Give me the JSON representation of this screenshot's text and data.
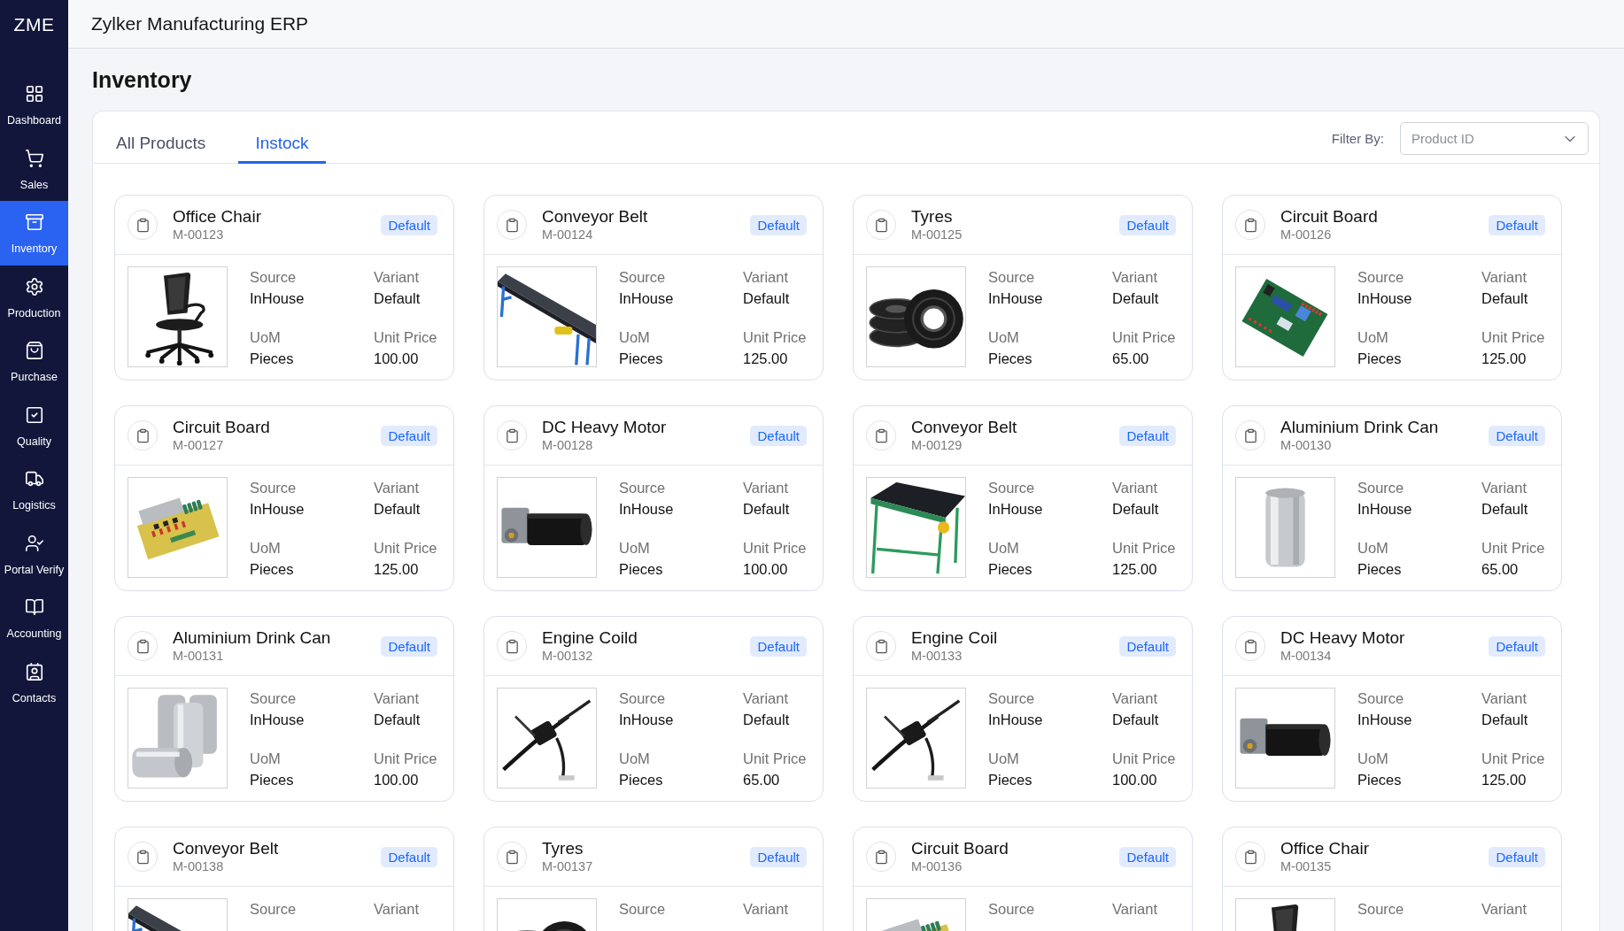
{
  "app": {
    "logo": "ZME",
    "title": "Zylker Manufacturing ERP"
  },
  "sidebar": {
    "items": [
      {
        "label": "Dashboard",
        "selected": false
      },
      {
        "label": "Sales",
        "selected": false
      },
      {
        "label": "Inventory",
        "selected": true
      },
      {
        "label": "Production",
        "selected": false
      },
      {
        "label": "Purchase",
        "selected": false
      },
      {
        "label": "Quality",
        "selected": false
      },
      {
        "label": "Logistics",
        "selected": false
      },
      {
        "label": "Portal Verify",
        "selected": false
      },
      {
        "label": "Accounting",
        "selected": false
      },
      {
        "label": "Contacts",
        "selected": false
      }
    ]
  },
  "page": {
    "title": "Inventory"
  },
  "tabs": [
    {
      "label": "All Products",
      "selected": false
    },
    {
      "label": "Instock",
      "selected": true
    }
  ],
  "filter": {
    "label": "Filter By:",
    "placeholder": "Product ID"
  },
  "products": [
    {
      "name": "Office Chair",
      "code": "M-00123",
      "badge": "Default",
      "kind": "chair",
      "fields": [
        {
          "label": "Source",
          "value": "InHouse"
        },
        {
          "label": "Variant",
          "value": "Default"
        },
        {
          "label": "UoM",
          "value": "Pieces"
        },
        {
          "label": "Unit Price",
          "value": "100.00"
        }
      ]
    },
    {
      "name": "Conveyor Belt",
      "code": "M-00124",
      "badge": "Default",
      "kind": "conveyor",
      "fields": [
        {
          "label": "Source",
          "value": "InHouse"
        },
        {
          "label": "Variant",
          "value": "Default"
        },
        {
          "label": "UoM",
          "value": "Pieces"
        },
        {
          "label": "Unit Price",
          "value": "125.00"
        }
      ]
    },
    {
      "name": "Tyres",
      "code": "M-00125",
      "badge": "Default",
      "kind": "tyres",
      "fields": [
        {
          "label": "Source",
          "value": "InHouse"
        },
        {
          "label": "Variant",
          "value": "Default"
        },
        {
          "label": "UoM",
          "value": "Pieces"
        },
        {
          "label": "Unit Price",
          "value": "65.00"
        }
      ]
    },
    {
      "name": "Circuit Board",
      "code": "M-00126",
      "badge": "Default",
      "kind": "circuit_green",
      "fields": [
        {
          "label": "Source",
          "value": "InHouse"
        },
        {
          "label": "Variant",
          "value": "Default"
        },
        {
          "label": "UoM",
          "value": "Pieces"
        },
        {
          "label": "Unit Price",
          "value": "125.00"
        }
      ]
    },
    {
      "name": "Circuit Board",
      "code": "M-00127",
      "badge": "Default",
      "kind": "circuit_yellow",
      "fields": [
        {
          "label": "Source",
          "value": "InHouse"
        },
        {
          "label": "Variant",
          "value": "Default"
        },
        {
          "label": "UoM",
          "value": "Pieces"
        },
        {
          "label": "Unit Price",
          "value": "125.00"
        }
      ]
    },
    {
      "name": "DC Heavy Motor",
      "code": "M-00128",
      "badge": "Default",
      "kind": "motor",
      "fields": [
        {
          "label": "Source",
          "value": "InHouse"
        },
        {
          "label": "Variant",
          "value": "Default"
        },
        {
          "label": "UoM",
          "value": "Pieces"
        },
        {
          "label": "Unit Price",
          "value": "100.00"
        }
      ]
    },
    {
      "name": "Conveyor Belt",
      "code": "M-00129",
      "badge": "Default",
      "kind": "conveyor_green",
      "fields": [
        {
          "label": "Source",
          "value": "InHouse"
        },
        {
          "label": "Variant",
          "value": "Default"
        },
        {
          "label": "UoM",
          "value": "Pieces"
        },
        {
          "label": "Unit Price",
          "value": "125.00"
        }
      ]
    },
    {
      "name": "Aluminium Drink Can",
      "code": "M-00130",
      "badge": "Default",
      "kind": "can",
      "fields": [
        {
          "label": "Source",
          "value": "InHouse"
        },
        {
          "label": "Variant",
          "value": "Default"
        },
        {
          "label": "UoM",
          "value": "Pieces"
        },
        {
          "label": "Unit Price",
          "value": "65.00"
        }
      ]
    },
    {
      "name": "Aluminium Drink Can",
      "code": "M-00131",
      "badge": "Default",
      "kind": "cans",
      "fields": [
        {
          "label": "Source",
          "value": "InHouse"
        },
        {
          "label": "Variant",
          "value": "Default"
        },
        {
          "label": "UoM",
          "value": "Pieces"
        },
        {
          "label": "Unit Price",
          "value": "100.00"
        }
      ]
    },
    {
      "name": "Engine Coild",
      "code": "M-00132",
      "badge": "Default",
      "kind": "coil",
      "fields": [
        {
          "label": "Source",
          "value": "InHouse"
        },
        {
          "label": "Variant",
          "value": "Default"
        },
        {
          "label": "UoM",
          "value": "Pieces"
        },
        {
          "label": "Unit Price",
          "value": "65.00"
        }
      ]
    },
    {
      "name": "Engine Coil",
      "code": "M-00133",
      "badge": "Default",
      "kind": "coil",
      "fields": [
        {
          "label": "Source",
          "value": "InHouse"
        },
        {
          "label": "Variant",
          "value": "Default"
        },
        {
          "label": "UoM",
          "value": "Pieces"
        },
        {
          "label": "Unit Price",
          "value": "100.00"
        }
      ]
    },
    {
      "name": "DC Heavy Motor",
      "code": "M-00134",
      "badge": "Default",
      "kind": "motor",
      "fields": [
        {
          "label": "Source",
          "value": "InHouse"
        },
        {
          "label": "Variant",
          "value": "Default"
        },
        {
          "label": "UoM",
          "value": "Pieces"
        },
        {
          "label": "Unit Price",
          "value": "125.00"
        }
      ]
    },
    {
      "name": "Conveyor Belt",
      "code": "M-00138",
      "badge": "Default",
      "kind": "conveyor",
      "fields": [
        {
          "label": "Source"
        },
        {
          "label": "Variant"
        }
      ]
    },
    {
      "name": "Tyres",
      "code": "M-00137",
      "badge": "Default",
      "kind": "tyres",
      "fields": [
        {
          "label": "Source"
        },
        {
          "label": "Variant"
        }
      ]
    },
    {
      "name": "Circuit Board",
      "code": "M-00136",
      "badge": "Default",
      "kind": "circuit_yellow",
      "fields": [
        {
          "label": "Source"
        },
        {
          "label": "Variant"
        }
      ]
    },
    {
      "name": "Office Chair",
      "code": "M-00135",
      "badge": "Default",
      "kind": "chair",
      "fields": [
        {
          "label": "Source"
        },
        {
          "label": "Variant"
        }
      ]
    }
  ]
}
